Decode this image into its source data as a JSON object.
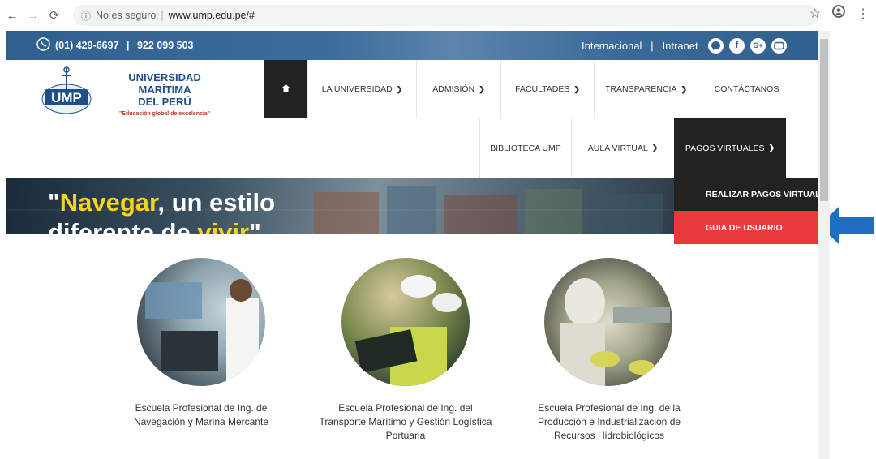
{
  "browser": {
    "security_label": "No es seguro",
    "url": "www.ump.edu.pe/#"
  },
  "topbar": {
    "phone1": "(01) 429-6697",
    "phone2": "922 099 503",
    "link_international": "Internacional",
    "link_intranet": "Intranet",
    "socials": [
      "messenger-icon",
      "facebook-icon",
      "google-plus-icon",
      "youtube-icon"
    ]
  },
  "logo": {
    "line1": "UNIVERSIDAD MARÍTIMA",
    "line2": "DEL PERÚ",
    "tagline": "\"Educación global de excelencia\"",
    "emblem_text": "UMP"
  },
  "menu": {
    "row1": [
      "LA UNIVERSIDAD",
      "ADMISIÓN",
      "FACULTADES",
      "TRANSPARENCIA",
      "CONTÁCTANOS"
    ],
    "row2": [
      "BIBLIOTECA UMP",
      "AULA VIRTUAL",
      "PAGOS VIRTUALES"
    ]
  },
  "dropdown": {
    "item1": "REALIZAR PAGOS VIRTUALES",
    "item2": "GUIA DE USUARIO"
  },
  "banner": {
    "quote_open": "\"",
    "word1": "Navegar",
    "part1": ", un estilo",
    "part2": "diferente de ",
    "word2": "vivir",
    "quote_close": "\""
  },
  "schools": [
    {
      "line1": "Escuela Profesional de Ing. de",
      "line2": "Navegación y Marina Mercante",
      "line3": ""
    },
    {
      "line1": "Escuela Profesional de Ing. del",
      "line2": "Transporte Marítimo y Gestión Logística",
      "line3": "Portuaria"
    },
    {
      "line1": "Escuela Profesional de Ing. de la",
      "line2": "Producción e Industrialización de",
      "line3": "Recursos Hidrobiológicos"
    }
  ],
  "colors": {
    "topbar": "#2f5f8e",
    "logo_blue": "#1d4f8c",
    "dark_menu": "#222222",
    "highlight_red": "#e83a3a",
    "banner_yellow": "#f7d417",
    "arrow_blue": "#1e6fc1"
  }
}
